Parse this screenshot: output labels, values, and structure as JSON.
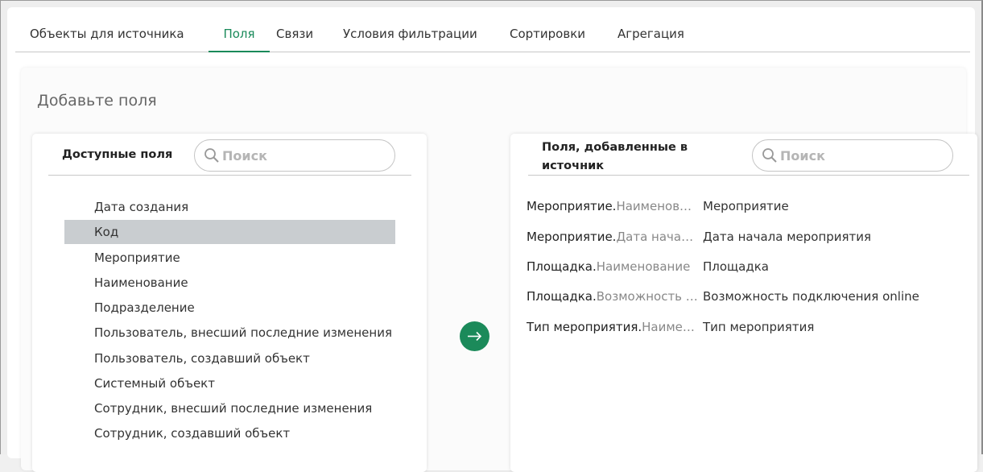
{
  "tabs": [
    {
      "label": "Объекты для источника"
    },
    {
      "label": "Поля"
    },
    {
      "label": "Связи"
    },
    {
      "label": "Условия фильтрации"
    },
    {
      "label": "Сортировки"
    },
    {
      "label": "Агрегация"
    }
  ],
  "active_tab": "Поля",
  "panel_title": "Добавьте поля",
  "available": {
    "title": "Доступные поля",
    "search_placeholder": "Поиск",
    "items": [
      {
        "label": "Дата создания"
      },
      {
        "label": "Код"
      },
      {
        "label": "Мероприятие"
      },
      {
        "label": "Наименование"
      },
      {
        "label": "Подразделение"
      },
      {
        "label": "Пользователь, внесший последние изменения"
      },
      {
        "label": "Пользователь, создавший объект"
      },
      {
        "label": "Системный объект"
      },
      {
        "label": "Сотрудник, внесший последние изменения"
      },
      {
        "label": "Сотрудник, создавший объект"
      }
    ],
    "selected_item": "Код"
  },
  "added": {
    "title_line1": "Поля, добавленные в",
    "title_line2": "источник",
    "search_placeholder": "Поиск",
    "rows": [
      {
        "object": "Мероприятие.",
        "field": "Наименов…",
        "name": "Мероприятие"
      },
      {
        "object": "Мероприятие.",
        "field": "Дата нача…",
        "name": "Дата начала мероприятия"
      },
      {
        "object": "Площадка.",
        "field": "Наименование",
        "name": "Площадка"
      },
      {
        "object": "Площадка.",
        "field": "Возможность …",
        "name": "Возможность подключения online"
      },
      {
        "object": "Тип мероприятия.",
        "field": "Наиме…",
        "name": "Тип мероприятия"
      }
    ]
  },
  "icons": {
    "search": "search-icon",
    "move": "arrow-right-icon"
  },
  "colors": {
    "accent": "#1a8a5a",
    "selected_row": "#c9cdd0",
    "muted_text": "#888888"
  }
}
